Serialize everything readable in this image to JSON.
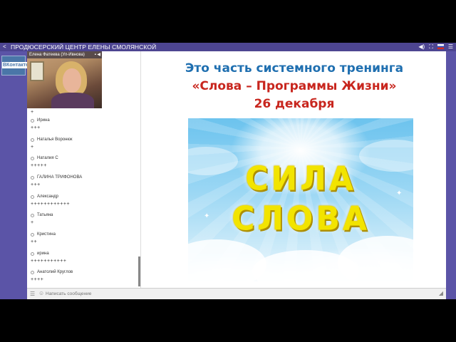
{
  "topbar": {
    "title": "ПРОДЮСЕРСКИЙ ЦЕНТР ЕЛЕНЫ СМОЛЯНСКОЙ"
  },
  "vk": {
    "logo_text": "ВКонтакте"
  },
  "webcam": {
    "label": "Елена Фатеева (Ул-Ивнова)"
  },
  "chat": {
    "messages": [
      {
        "name": "Ирина",
        "text": "+++"
      },
      {
        "name": "Наталья Воронюк",
        "text": "+"
      },
      {
        "name": "Наталия С",
        "text": "+++++"
      },
      {
        "name": "ГАЛИНА ТРИФОНОВА",
        "text": "+++"
      },
      {
        "name": "Александр",
        "text": "++++++++++++"
      },
      {
        "name": "Татьяна",
        "text": "+"
      },
      {
        "name": "Кристина",
        "text": "++"
      },
      {
        "name": "ирина",
        "text": "+++++++++++"
      },
      {
        "name": "Анатолий Круглов",
        "text": "++++"
      }
    ],
    "first_partial_text": "+"
  },
  "composer": {
    "placeholder": "Написать сообщение"
  },
  "slide": {
    "line1": "Это часть системного тренинга",
    "line2": "«Слова – Программы Жизни»",
    "line3": "26 декабря",
    "banner_word1": "СИЛА",
    "banner_word2": "СЛОВА"
  }
}
